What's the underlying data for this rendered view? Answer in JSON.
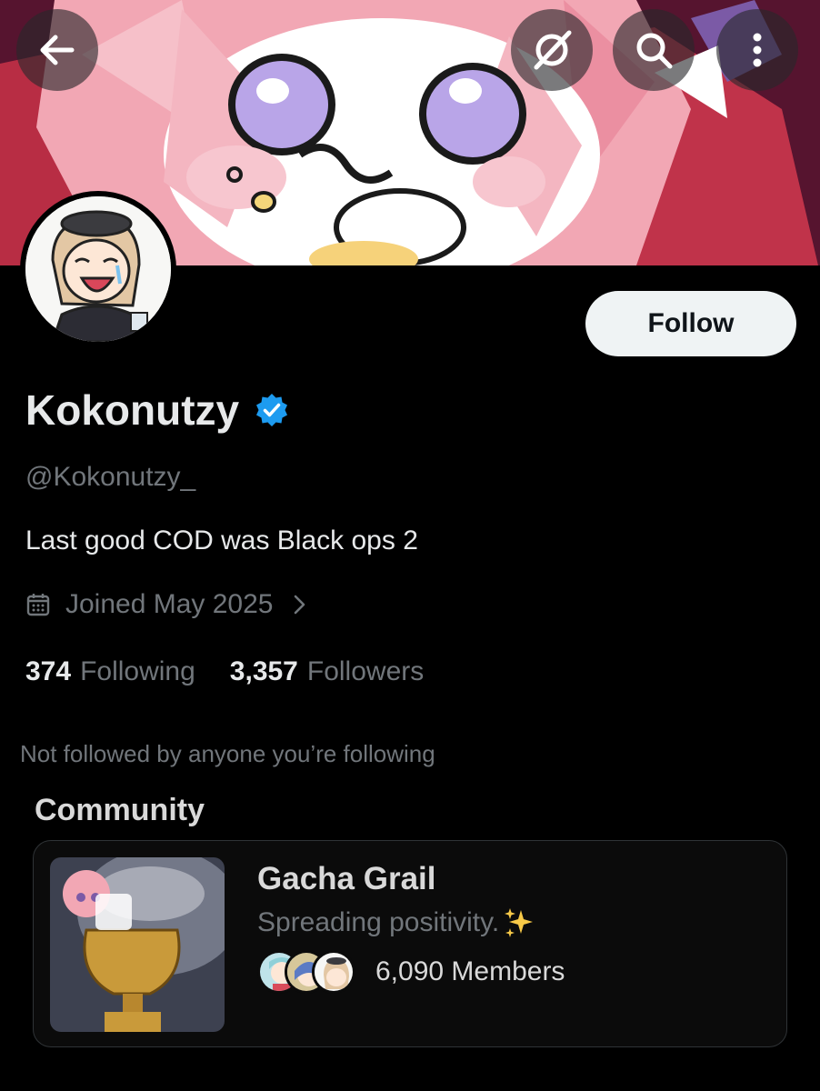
{
  "header": {
    "back_icon": "arrow-left-icon",
    "grok_icon": "grok-icon",
    "search_icon": "search-icon",
    "more_icon": "more-vertical-icon"
  },
  "profile": {
    "display_name": "Kokonutzy",
    "verified": true,
    "handle": "@Kokonutzy_",
    "bio": "Last good COD was Black ops 2",
    "joined": "Joined May 2025",
    "following_count": "374",
    "following_label": "Following",
    "followers_count": "3,357",
    "followers_label": "Followers",
    "not_followed_text": "Not followed by anyone you’re following",
    "follow_button": "Follow"
  },
  "community": {
    "section_title": "Community",
    "name": "Gacha Grail",
    "description": "Spreading positivity.",
    "description_emoji": "sparkles-icon",
    "members": "6,090 Members"
  },
  "colors": {
    "verified_blue": "#1d9bf0",
    "muted_text": "#71767b",
    "primary_text": "#e7e9ea",
    "background": "#000000",
    "follow_button_bg": "#eff3f4"
  }
}
